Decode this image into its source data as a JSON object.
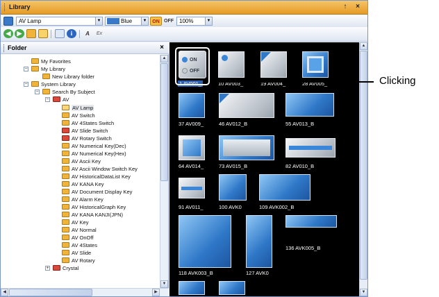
{
  "window": {
    "title": "Library",
    "title_buttons": "↑ ×",
    "colors": {
      "title_bg": "#e9a636",
      "accent": "#3a78c8",
      "gallery_bg": "#000000"
    }
  },
  "toolbar1": {
    "library_combo": "AV Lamp",
    "color_combo": "Blue",
    "on_label": "ON",
    "off_label": "OFF",
    "zoom_combo": "100%"
  },
  "toolbar2": {
    "icons": [
      "back-icon",
      "forward-icon",
      "folder-up-icon",
      "view-icon",
      "copy-icon",
      "info-icon",
      "edit-label-icon",
      "font-icon"
    ],
    "lab_a": "A",
    "lab_b": "Ex"
  },
  "folder_pane": {
    "title": "Folder",
    "close": "×",
    "items": [
      {
        "label": "My Favorites"
      },
      {
        "label": "My Library"
      },
      {
        "label": "New Library folder"
      },
      {
        "label": "System Library"
      },
      {
        "label": "Search By Subject"
      },
      {
        "label": "AV"
      },
      {
        "label": "AV Lamp"
      },
      {
        "label": "AV Switch"
      },
      {
        "label": "AV 4States Switch"
      },
      {
        "label": "AV Slide Switch"
      },
      {
        "label": "AV Rotary Switch"
      },
      {
        "label": "AV Numerical Key(Dec)"
      },
      {
        "label": "AV Numerical Key(Hex)"
      },
      {
        "label": "AV Ascii Key"
      },
      {
        "label": "AV Ascii Window Switch Key"
      },
      {
        "label": "AV HistoricalDataList Key"
      },
      {
        "label": "AV KANA Key"
      },
      {
        "label": "AV Document Display Key"
      },
      {
        "label": "AV Alarm Key"
      },
      {
        "label": "AV HistoricalGraph Key"
      },
      {
        "label": "AV KANA KANJI(JPN)"
      },
      {
        "label": "AV Key"
      },
      {
        "label": "AV Normal"
      },
      {
        "label": "AV OnOff"
      },
      {
        "label": "AV 4States"
      },
      {
        "label": "AV Slide"
      },
      {
        "label": "AV Rotary"
      },
      {
        "label": "Crystal"
      }
    ]
  },
  "gallery": {
    "items": [
      {
        "label": "1 AV001_"
      },
      {
        "label": "10 AV003_"
      },
      {
        "label": "19 AV004_"
      },
      {
        "label": "28 AV005_"
      },
      {
        "label": "37 AV009_"
      },
      {
        "label": "46 AV012_B"
      },
      {
        "label": "55 AV013_B"
      },
      {
        "label": "64 AV014_"
      },
      {
        "label": "73 AV015_B"
      },
      {
        "label": "82 AV010_B"
      },
      {
        "label": "91 AV011_"
      },
      {
        "label": "100 AVK0"
      },
      {
        "label": "109 AVK002_B"
      },
      {
        "label": "118 AVK003_B"
      },
      {
        "label": "127 AVK0"
      },
      {
        "label": "136 AVK005_B"
      }
    ],
    "lamp_on": "ON",
    "lamp_off": "OFF"
  },
  "callout": {
    "text": "Clicking"
  }
}
